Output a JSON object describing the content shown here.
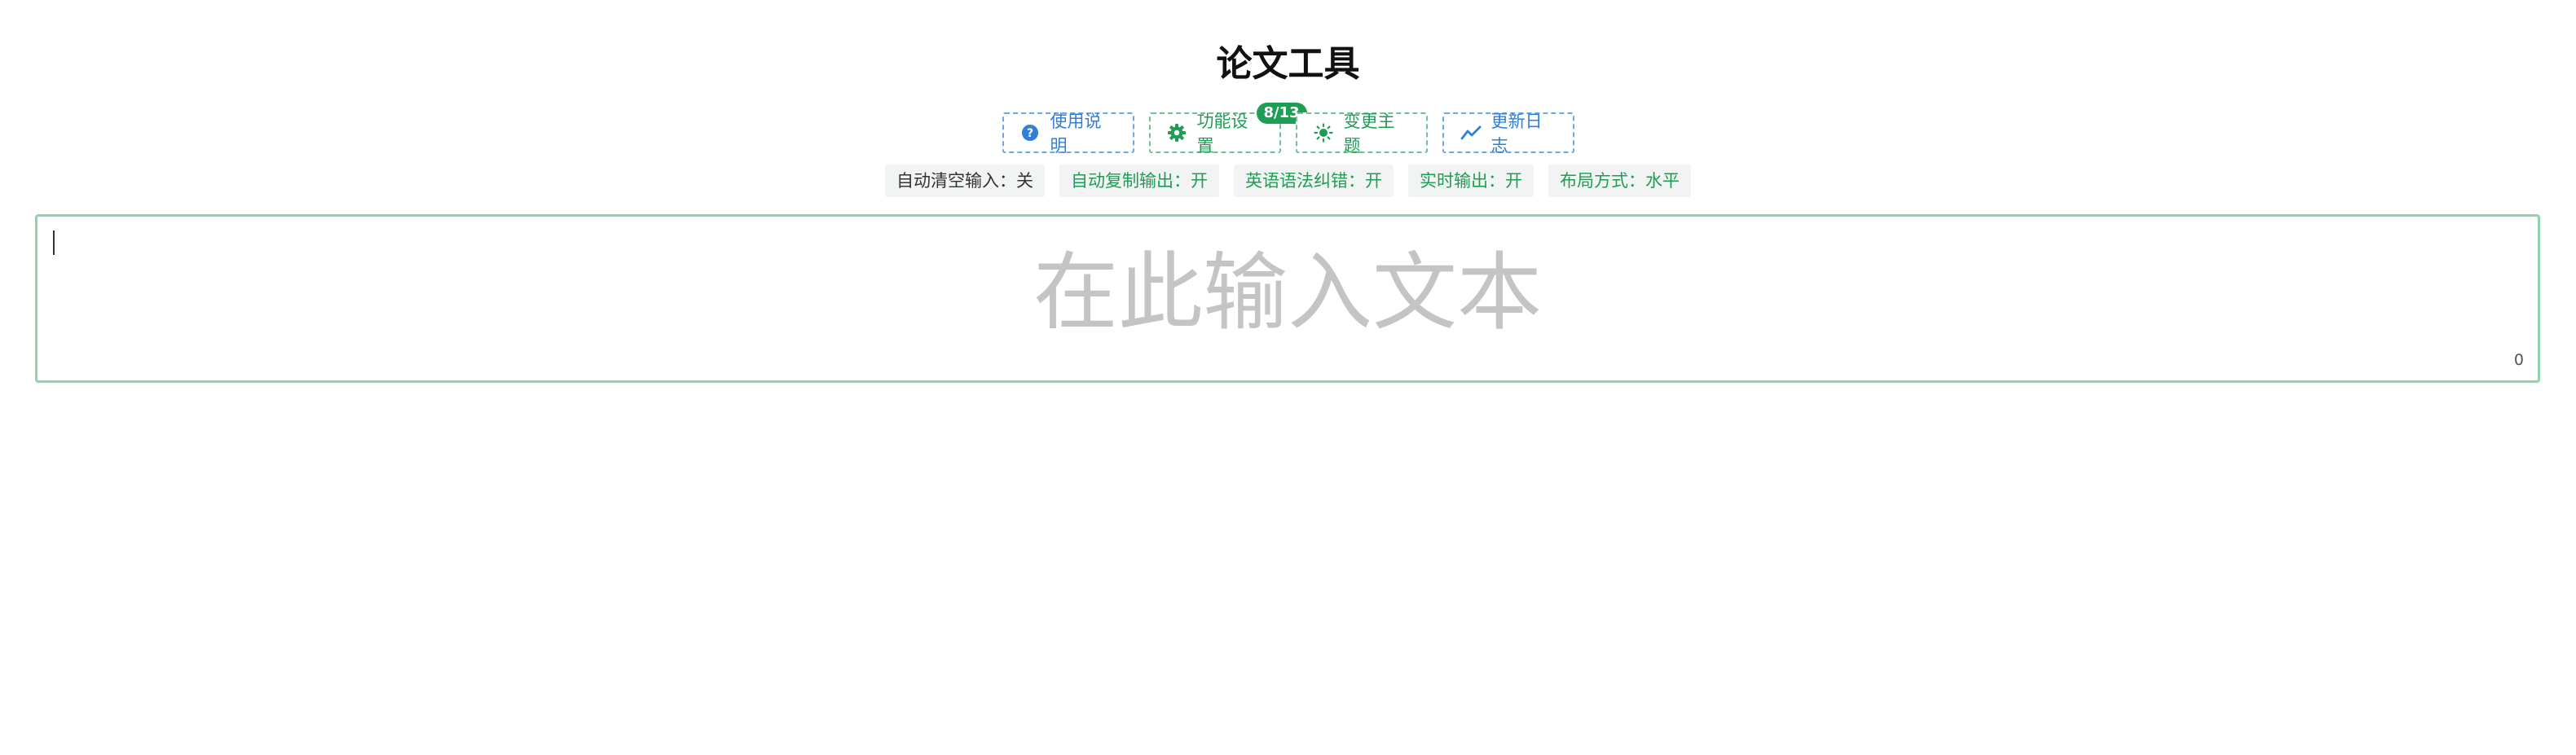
{
  "app": {
    "title": "论文工具"
  },
  "toolbar": {
    "help_label": "使用说明",
    "help_icon": "question-circle-icon",
    "settings_label": "功能设置",
    "settings_icon": "gear-icon",
    "settings_badge": "8/13",
    "theme_label": "变更主题",
    "theme_icon": "sun-icon",
    "changelog_label": "更新日志",
    "changelog_icon": "trend-line-icon"
  },
  "status": {
    "auto_clear": "自动清空输入：关",
    "auto_copy": "自动复制输出：开",
    "grammar": "英语语法纠错：开",
    "realtime": "实时输出：开",
    "layout": "布局方式：水平"
  },
  "editor": {
    "placeholder": "在此输入文本",
    "char_count": "0"
  },
  "colors": {
    "blue_accent": "#2f7fd8",
    "green_accent": "#1f9d55",
    "editor_border": "#8fd4ad",
    "placeholder": "#c4c4c4"
  }
}
